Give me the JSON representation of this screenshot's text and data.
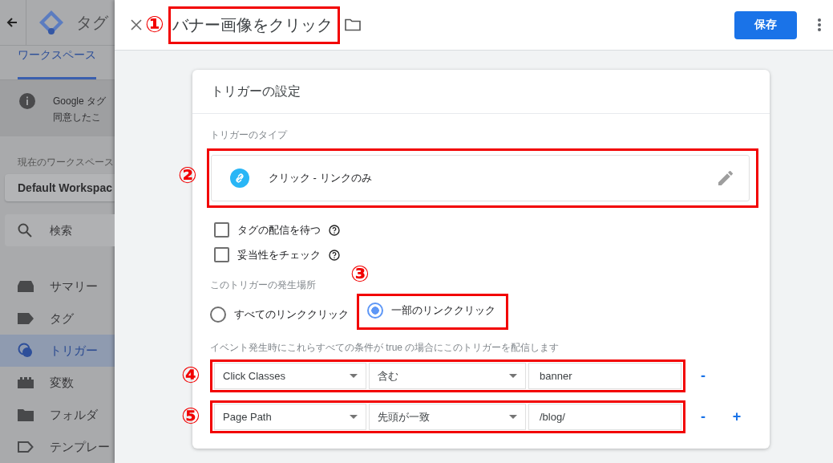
{
  "sidebar": {
    "header_title": "タグ",
    "tab": {
      "label": "ワークスペース",
      "selected": true
    },
    "notice": [
      "Google タグ",
      "同意したこ"
    ],
    "workspace_label": "現在のワークスペース",
    "workspace": "Default Workspac",
    "search": {
      "placeholder": "検索"
    },
    "items": [
      {
        "label": "サマリー",
        "kind": "summary",
        "selected": false
      },
      {
        "label": "タグ",
        "kind": "tag",
        "selected": false
      },
      {
        "label": "トリガー",
        "kind": "trigger",
        "selected": true
      },
      {
        "label": "変数",
        "kind": "variable",
        "selected": false
      },
      {
        "label": "フォルダ",
        "kind": "folder",
        "selected": false
      },
      {
        "label": "テンプレー",
        "kind": "template",
        "selected": false
      }
    ]
  },
  "editor": {
    "title": "バナー画像をクリック",
    "title_callout": "①",
    "save": "保存"
  },
  "card": {
    "heading": "トリガーの設定",
    "type_label": "トリガーのタイプ",
    "type": {
      "name": "クリック - リンクのみ",
      "callout": "②"
    },
    "options": [
      {
        "label": "タグの配信を待つ",
        "checked": false
      },
      {
        "label": "妥当性をチェック",
        "checked": false
      }
    ],
    "scope_label": "このトリガーの発生場所",
    "scope": [
      {
        "label": "すべてのリンククリック",
        "selected": false
      },
      {
        "label": "一部のリンククリック",
        "selected": true,
        "callout": "③"
      }
    ],
    "conditions_label": "イベント発生時にこれらすべての条件が true の場合にこのトリガーを配信します",
    "conditions": [
      {
        "variable": "Click Classes",
        "operator": "含む",
        "value": "banner",
        "callout": "④",
        "remove": "-"
      },
      {
        "variable": "Page Path",
        "operator": "先頭が一致",
        "value": "/blog/",
        "callout": "⑤",
        "remove": "-",
        "add": "+"
      }
    ]
  }
}
